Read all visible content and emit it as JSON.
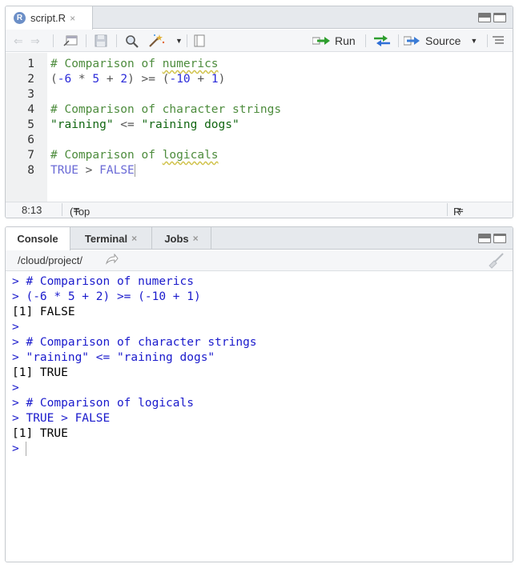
{
  "editor": {
    "tab": {
      "title": "script.R",
      "close": "×"
    },
    "toolbar": {
      "run_label": "Run",
      "source_label": "Source"
    },
    "lines": [
      {
        "n": "1",
        "segments": [
          {
            "t": "# Comparison of ",
            "c": "cm"
          },
          {
            "t": "numerics",
            "c": "cm squig"
          }
        ]
      },
      {
        "n": "2",
        "segments": [
          {
            "t": "(",
            "c": "op"
          },
          {
            "t": "-6",
            "c": "num"
          },
          {
            "t": " * ",
            "c": "op"
          },
          {
            "t": "5",
            "c": "num"
          },
          {
            "t": " + ",
            "c": "op"
          },
          {
            "t": "2",
            "c": "num"
          },
          {
            "t": ") >= (",
            "c": "op"
          },
          {
            "t": "-10",
            "c": "num"
          },
          {
            "t": " + ",
            "c": "op"
          },
          {
            "t": "1",
            "c": "num"
          },
          {
            "t": ")",
            "c": "op"
          }
        ]
      },
      {
        "n": "3",
        "segments": []
      },
      {
        "n": "4",
        "segments": [
          {
            "t": "# Comparison of character strings",
            "c": "cm"
          }
        ]
      },
      {
        "n": "5",
        "segments": [
          {
            "t": "\"raining\"",
            "c": "str"
          },
          {
            "t": " <= ",
            "c": "op"
          },
          {
            "t": "\"raining dogs\"",
            "c": "str"
          }
        ]
      },
      {
        "n": "6",
        "segments": []
      },
      {
        "n": "7",
        "segments": [
          {
            "t": "# Comparison of ",
            "c": "cm"
          },
          {
            "t": "logicals",
            "c": "cm squig"
          }
        ]
      },
      {
        "n": "8",
        "segments": [
          {
            "t": "TRUE",
            "c": "kw"
          },
          {
            "t": " > ",
            "c": "op"
          },
          {
            "t": "FALSE",
            "c": "kw"
          }
        ],
        "cursor": true
      }
    ],
    "status": {
      "position": "8:13",
      "scope": "(Top Level)",
      "scope_arrow": "≑",
      "filetype": "R Script",
      "filetype_arrow": "≑"
    }
  },
  "console": {
    "tabs": [
      {
        "label": "Console",
        "active": true
      },
      {
        "label": "Terminal",
        "close": "×"
      },
      {
        "label": "Jobs",
        "close": "×"
      }
    ],
    "path": "/cloud/project/",
    "lines": [
      {
        "text": "> # Comparison of numerics",
        "kind": "cin"
      },
      {
        "text": "> (-6 * 5 + 2) >= (-10 + 1)",
        "kind": "cin"
      },
      {
        "text": "[1] FALSE",
        "kind": "cout"
      },
      {
        "text": ">",
        "kind": "cin"
      },
      {
        "text": "> # Comparison of character strings",
        "kind": "cin"
      },
      {
        "text": "> \"raining\" <= \"raining dogs\"",
        "kind": "cin"
      },
      {
        "text": "[1] TRUE",
        "kind": "cout"
      },
      {
        "text": ">",
        "kind": "cin"
      },
      {
        "text": "> # Comparison of logicals",
        "kind": "cin"
      },
      {
        "text": "> TRUE > FALSE",
        "kind": "cin"
      },
      {
        "text": "[1] TRUE",
        "kind": "cout"
      },
      {
        "text": "> ",
        "kind": "cin",
        "cursor": true
      }
    ]
  },
  "colors": {
    "accent_blue": "#1a1acc",
    "comment_green": "#4d8c3d",
    "string_green": "#116611",
    "run_green": "#2e9e2e"
  }
}
